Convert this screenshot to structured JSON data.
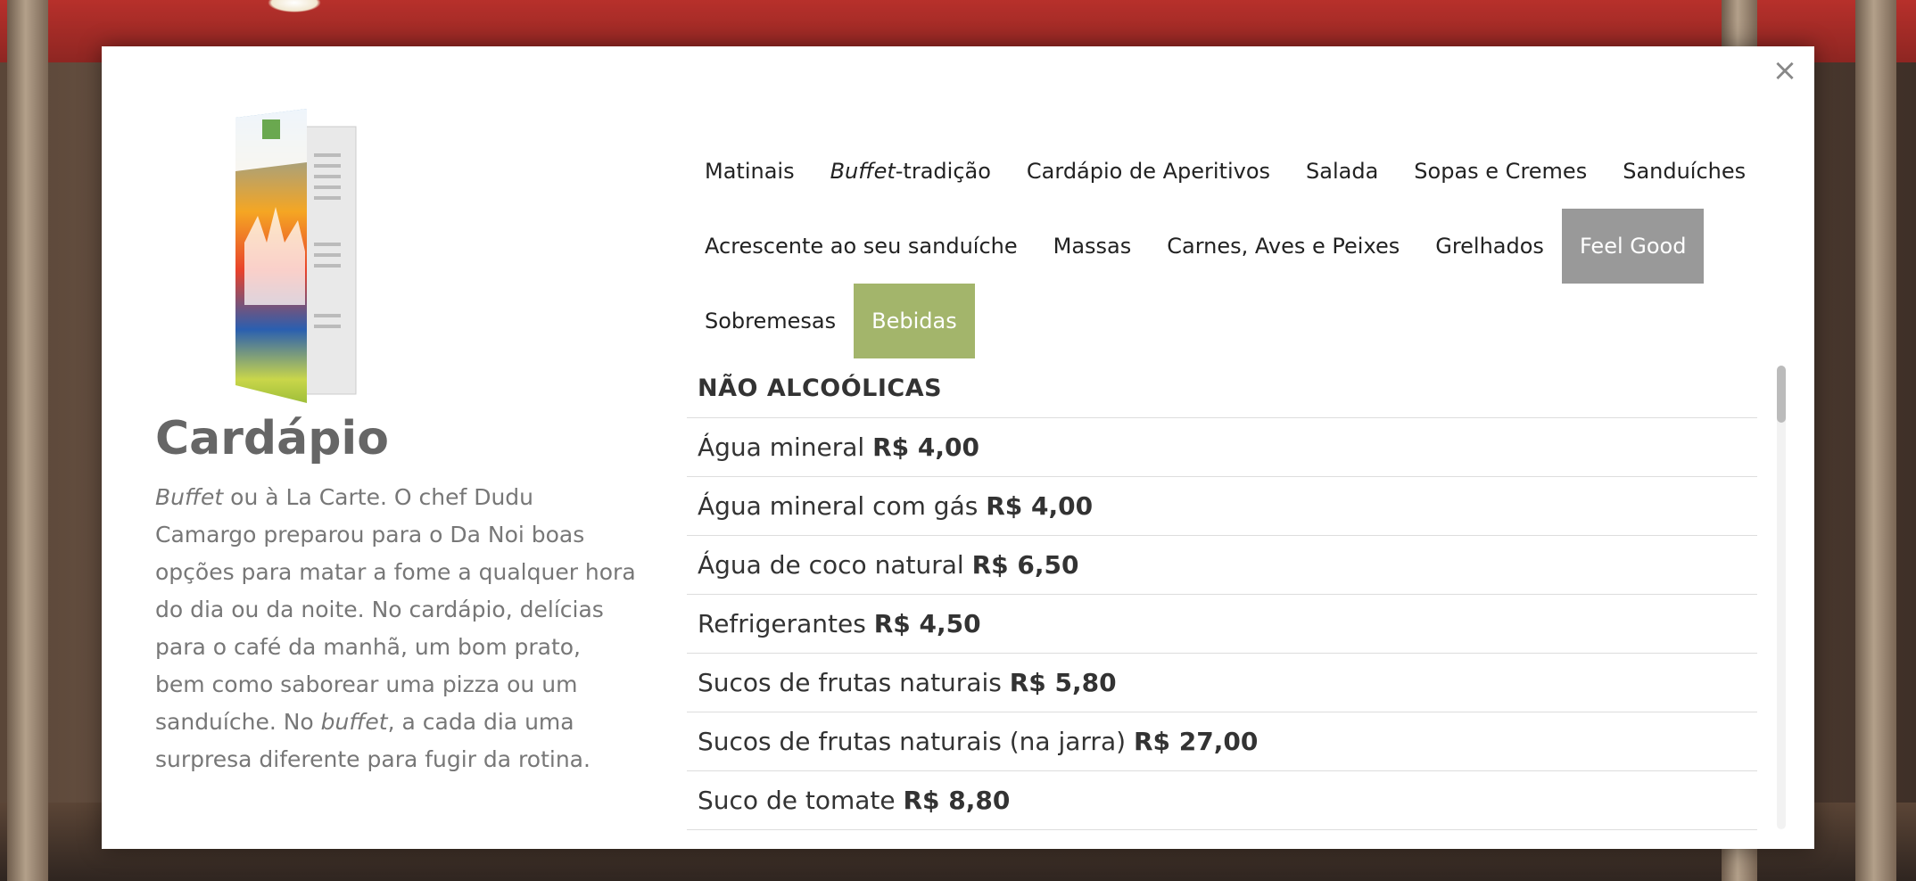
{
  "header": {
    "close_label": "×"
  },
  "intro": {
    "title": "Cardápio",
    "description_em_1": "Buffet",
    "description_1": " ou à La Carte. O chef Dudu Camargo preparou para o Da Noi boas opções para matar a fome a qualquer hora do dia ou da noite. No cardápio, delícias para o café da manhã, um bom prato, bem como saborear uma pizza ou um sanduíche. No ",
    "description_em_2": "buffet",
    "description_2": ", a cada dia uma surpresa diferente para fugir da rotina."
  },
  "tabs": {
    "matinais": "Matinais",
    "buffet_em": "Buffet",
    "buffet_rest": "-tradição",
    "aperitivos": "Cardápio de Aperitivos",
    "salada": "Salada",
    "sopas": "Sopas e Cremes",
    "sanduiches": "Sanduíches",
    "acrescente": "Acrescente ao seu sanduíche",
    "massas": "Massas",
    "carnes": "Carnes, Aves e Peixes",
    "grelhados": "Grelhados",
    "feel_good": "Feel Good",
    "sobremesas": "Sobremesas",
    "bebidas": "Bebidas"
  },
  "section": {
    "title": "NÃO ALCOÓLICAS"
  },
  "items": [
    {
      "name": "Água mineral",
      "price": "R$ 4,00"
    },
    {
      "name": "Água mineral com gás",
      "price": "R$ 4,00"
    },
    {
      "name": "Água de coco natural",
      "price": "R$ 6,50"
    },
    {
      "name": "Refrigerantes",
      "price": "R$ 4,50"
    },
    {
      "name": "Sucos de frutas naturais",
      "price": "R$ 5,80"
    },
    {
      "name": "Sucos de frutas naturais (na jarra)",
      "price": "R$ 27,00"
    },
    {
      "name": "Suco de tomate",
      "price": "R$ 8,80"
    }
  ],
  "colors": {
    "active_tab": "#a3b56b",
    "feel_good_tab": "#999999"
  }
}
